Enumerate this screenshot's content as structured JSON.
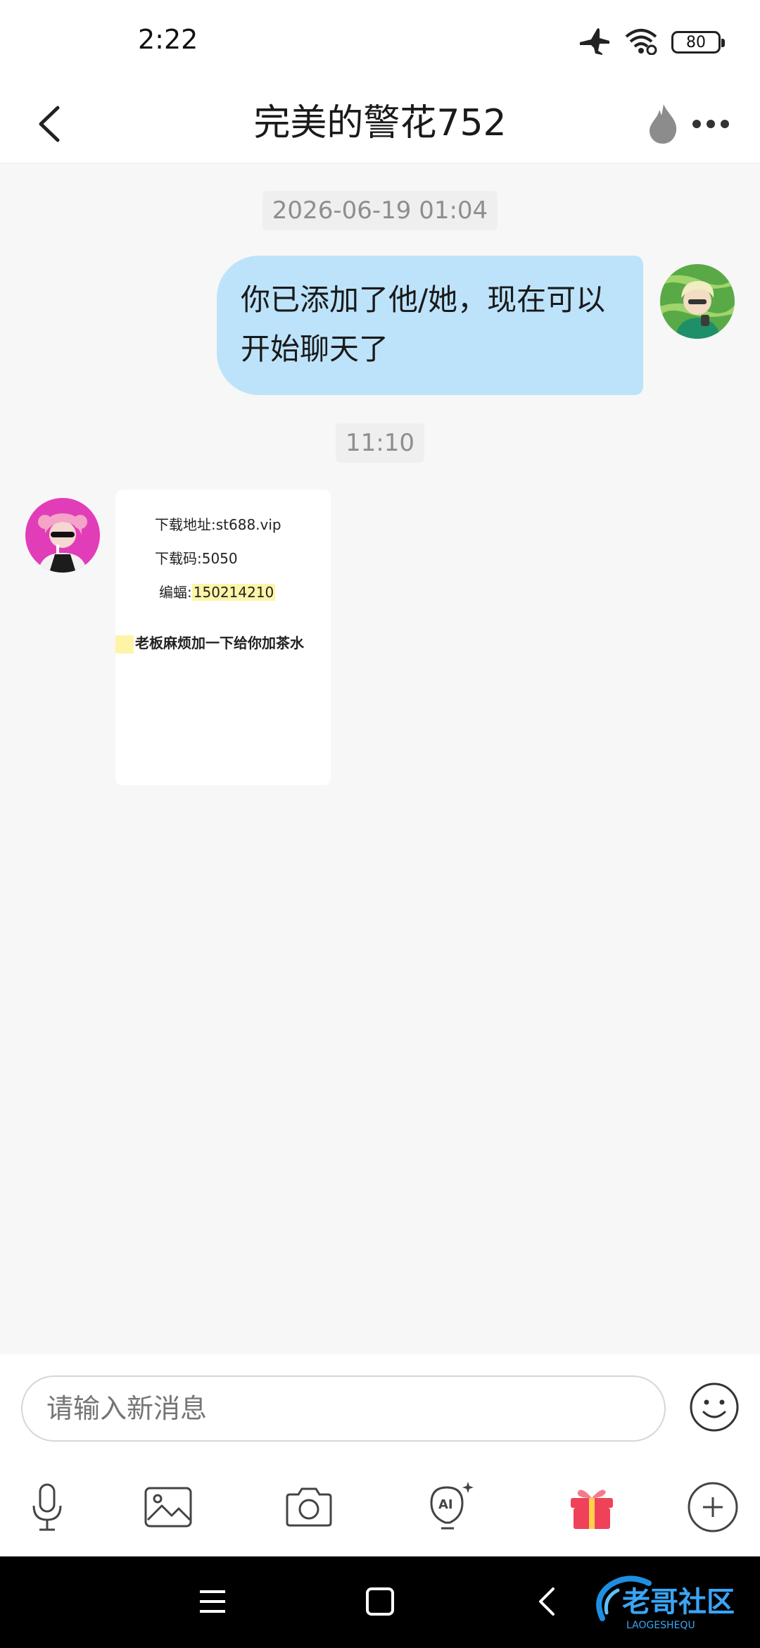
{
  "status_bar": {
    "time": "2:22",
    "battery": "80",
    "icons": [
      "airplane-icon",
      "wifi-icon",
      "battery-icon"
    ]
  },
  "nav": {
    "title": "完美的警花752",
    "back_icon": "chevron-left-icon",
    "fire_icon": "flame-icon",
    "more_icon": "more-dots-icon"
  },
  "chat": {
    "timestamps": [
      "2026-06-19 01:04",
      "11:10"
    ],
    "sent_message": "你已添加了他/她，现在可以开始聊天了",
    "image_message": {
      "line1": "下载地址:st688.vip",
      "line2": "下载码:5050",
      "line3_label": "编蝠:",
      "line3_value": "150214210",
      "line4": "老板麻烦加一下给你加茶水"
    }
  },
  "composer": {
    "placeholder": "请输入新消息",
    "tools": [
      "microphone-icon",
      "image-icon",
      "camera-icon",
      "ai-bulb-icon",
      "gift-icon",
      "plus-circle-icon"
    ],
    "accent_color": "#f0415b"
  },
  "system_nav": {
    "buttons": [
      "menu-icon",
      "home-icon",
      "back-icon"
    ],
    "watermark": "老哥社区",
    "watermark_sub": "LAOGESHEQU"
  },
  "colors": {
    "sent_bubble": "#bde3fb",
    "background": "#f7f7f7",
    "highlight": "#fdf4a8"
  }
}
